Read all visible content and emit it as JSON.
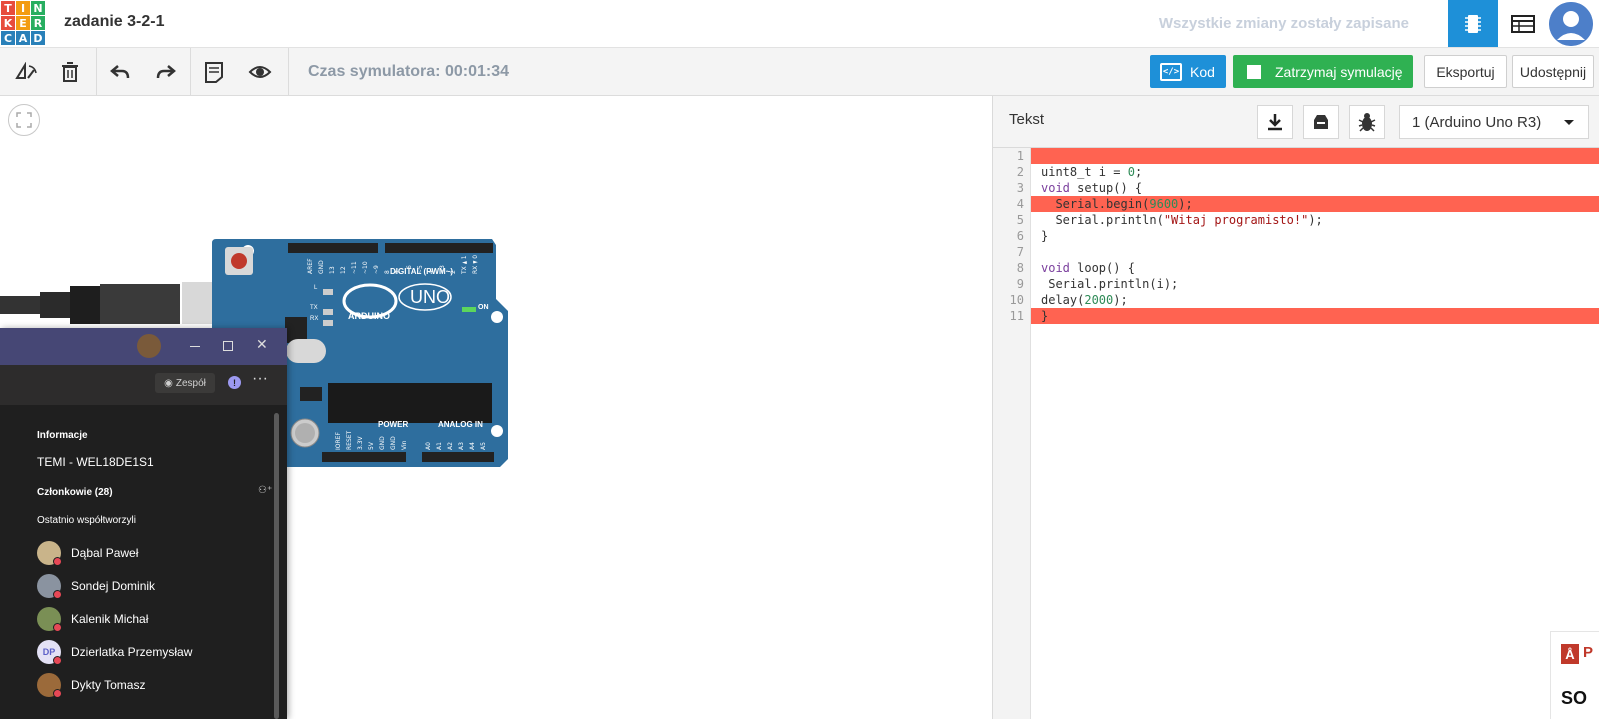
{
  "app": {
    "logo_letters": [
      "T",
      "I",
      "N",
      "K",
      "E",
      "R",
      "C",
      "A",
      "D"
    ],
    "logo_colors": [
      "#e74c3c",
      "#f39c12",
      "#27ae60",
      "#e74c3c",
      "#f39c12",
      "#27ae60",
      "#2980b9",
      "#2980b9",
      "#2980b9"
    ],
    "project_title": "zadanie 3-2-1",
    "save_status": "Wszystkie zmiany zostały zapisane"
  },
  "toolbar": {
    "sim_time": "Czas symulatora: 00:01:34",
    "code_label": "Kod",
    "stop_label": "Zatrzymaj symulację",
    "export_label": "Eksportuj",
    "share_label": "Udostępnij"
  },
  "code_panel": {
    "mode_label": "Tekst",
    "device_label": "1 (Arduino Uno R3)",
    "line_numbers": [
      "1",
      "2",
      "3",
      "4",
      "5",
      "6",
      "7",
      "8",
      "9",
      "10",
      "11"
    ],
    "error_lines": [
      1,
      4,
      11
    ]
  },
  "board": {
    "digital_label": "DIGITAL (PWM~)",
    "brand": "ARDUINO",
    "model": "UNO",
    "power_label": "POWER",
    "analog_label": "ANALOG IN",
    "on_label": "ON",
    "led_l": "L",
    "led_tx": "TX",
    "led_rx": "RX",
    "top_pins": [
      "AREF",
      "GND",
      "13",
      "12",
      "~11",
      "~10",
      "~9",
      "8",
      "7",
      "~6",
      "~5",
      "4",
      "~3",
      "2",
      "TX►1",
      "RX◄0"
    ],
    "power_pins": [
      "IOREF",
      "RESET",
      "3.3V",
      "5V",
      "GND",
      "GND",
      "Vin"
    ],
    "analog_pins": [
      "A0",
      "A1",
      "A2",
      "A3",
      "A4",
      "A5"
    ]
  },
  "teams": {
    "team_button": "Zespół",
    "info_heading": "Informacje",
    "team_name": "TEMI - WEL18DE1S1",
    "members_heading": "Członkowie (28)",
    "recent_heading": "Ostatnio współtworzyli",
    "members": [
      {
        "name": "Dąbal Paweł",
        "initials": "",
        "color": "#c9b48a"
      },
      {
        "name": "Sondej Dominik",
        "initials": "",
        "color": "#8a93a0"
      },
      {
        "name": "Kalenik Michał",
        "initials": "",
        "color": "#7a8f55"
      },
      {
        "name": "Dzierlatka Przemysław",
        "initials": "DP",
        "color": "#e3e1f5"
      },
      {
        "name": "Dykty Tomasz",
        "initials": "",
        "color": "#9b6a3a"
      }
    ]
  },
  "corner_ad": {
    "letter_top": "P",
    "text_bottom": "SO"
  }
}
